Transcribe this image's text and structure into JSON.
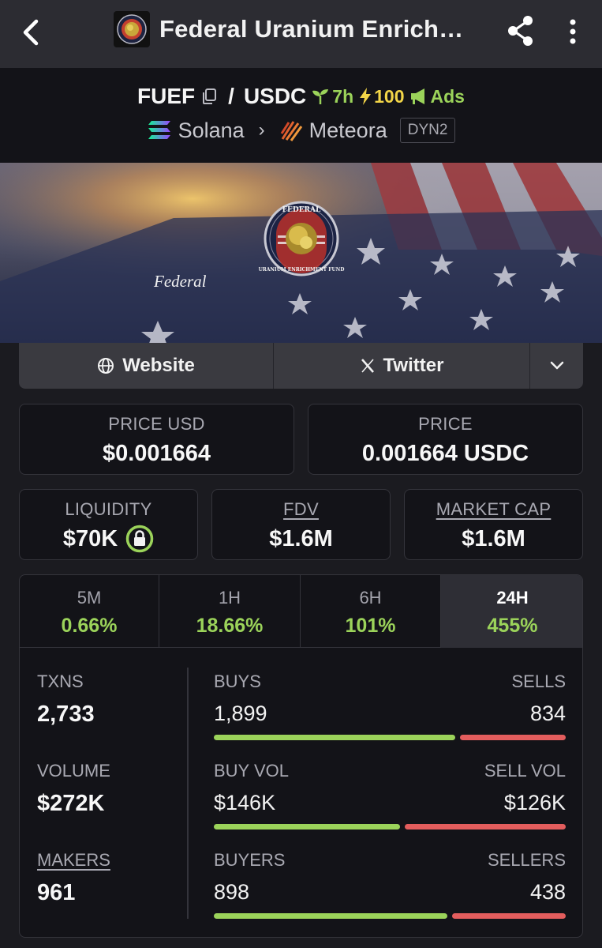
{
  "app_bar": {
    "title": "Federal Uranium Enrich…"
  },
  "pair": {
    "base": "FUEF",
    "quote": "USDC",
    "separator": "/",
    "age": "7h",
    "boost": "100",
    "ads": "Ads",
    "chain": "Solana",
    "dex": "Meteora",
    "dex_type": "DYN2"
  },
  "banner": {
    "text": "Federal",
    "seal_top_text": "FEDERAL",
    "seal_bottom_text": "URANIUM ENRICHMENT FUND"
  },
  "links": {
    "website": "Website",
    "twitter": "Twitter"
  },
  "price": {
    "usd_label": "PRICE USD",
    "usd_value": "$0.001664",
    "native_label": "PRICE",
    "native_value": "0.001664 USDC"
  },
  "metrics": {
    "liquidity_label": "LIQUIDITY",
    "liquidity_value": "$70K",
    "fdv_label": "FDV",
    "fdv_value": "$1.6M",
    "mcap_label": "MARKET CAP",
    "mcap_value": "$1.6M"
  },
  "timeframes": [
    {
      "label": "5M",
      "change": "0.66%"
    },
    {
      "label": "1H",
      "change": "18.66%"
    },
    {
      "label": "6H",
      "change": "101%"
    },
    {
      "label": "24H",
      "change": "455%"
    }
  ],
  "active_timeframe": "24H",
  "stats": {
    "txns_label": "TXNS",
    "txns_value": "2,733",
    "volume_label": "VOLUME",
    "volume_value": "$272K",
    "makers_label": "MAKERS",
    "makers_value": "961",
    "buys_label": "BUYS",
    "buys_value": "1,899",
    "sells_label": "SELLS",
    "sells_value": "834",
    "buy_vol_label": "BUY VOL",
    "buy_vol_value": "$146K",
    "sell_vol_label": "SELL VOL",
    "sell_vol_value": "$126K",
    "buyers_label": "BUYERS",
    "buyers_value": "898",
    "sellers_label": "SELLERS",
    "sellers_value": "438"
  },
  "bar_ratios": {
    "txns_buy_fraction": 0.695,
    "volume_buy_fraction": 0.537,
    "makers_buy_fraction": 0.672
  },
  "colors": {
    "positive": "#9bd35a",
    "negative": "#e35d5d",
    "boost": "#f2d548",
    "background": "#1b1b20"
  },
  "icons": {
    "back": "chevron-left-icon",
    "share": "share-icon",
    "more": "more-vertical-icon",
    "copy": "copy-icon",
    "age": "sprout-icon",
    "boost": "lightning-icon",
    "ads": "megaphone-icon",
    "chain": "solana-icon",
    "dex": "meteora-icon",
    "website": "globe-icon",
    "twitter": "x-icon",
    "links_more": "chevron-down-icon",
    "liquidity_lock": "lock-icon"
  }
}
